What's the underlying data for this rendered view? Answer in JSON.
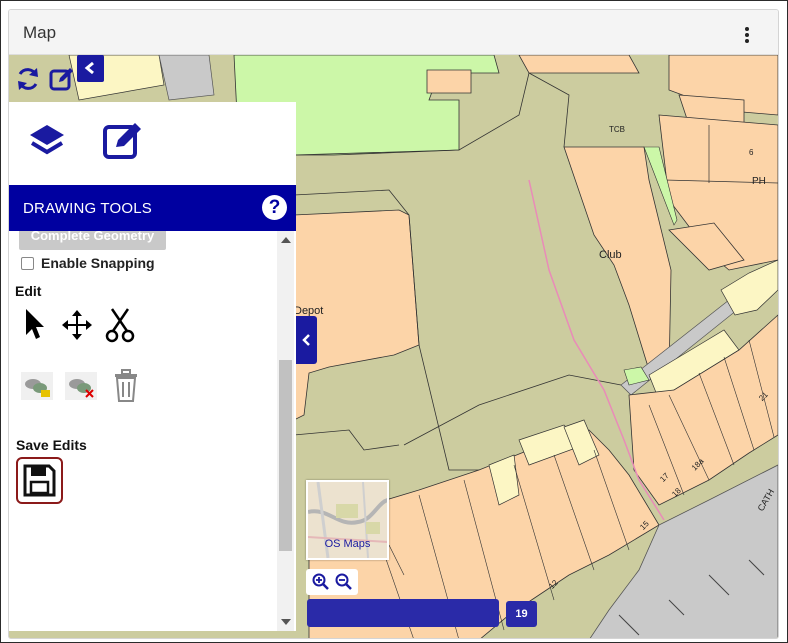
{
  "panel": {
    "title": "Map"
  },
  "drawing_tools": {
    "title": "DRAWING TOOLS",
    "help_glyph": "?",
    "complete_geometry_label": "Complete Geometry",
    "enable_snapping_label": "Enable Snapping",
    "edit_section_label": "Edit",
    "save_section_label": "Save Edits"
  },
  "map": {
    "labels": {
      "tcb": "TCB",
      "ph": "PH",
      "six": "6",
      "club": "Club",
      "depot": "Depot",
      "n21": "21",
      "n18a": "18a",
      "n17": "17",
      "n18": "18",
      "n15": "15",
      "n12": "12",
      "cath": "CATH"
    },
    "overview_label": "OS Maps",
    "zoom_level": "19"
  },
  "colors": {
    "accent": "#0000a0",
    "ground": "#cccc9f",
    "building": "#fcd4a8",
    "green": "#ccf7a8",
    "road": "#c9c9c9",
    "yellow": "#fcf6c4",
    "path": "#e98bb8"
  }
}
